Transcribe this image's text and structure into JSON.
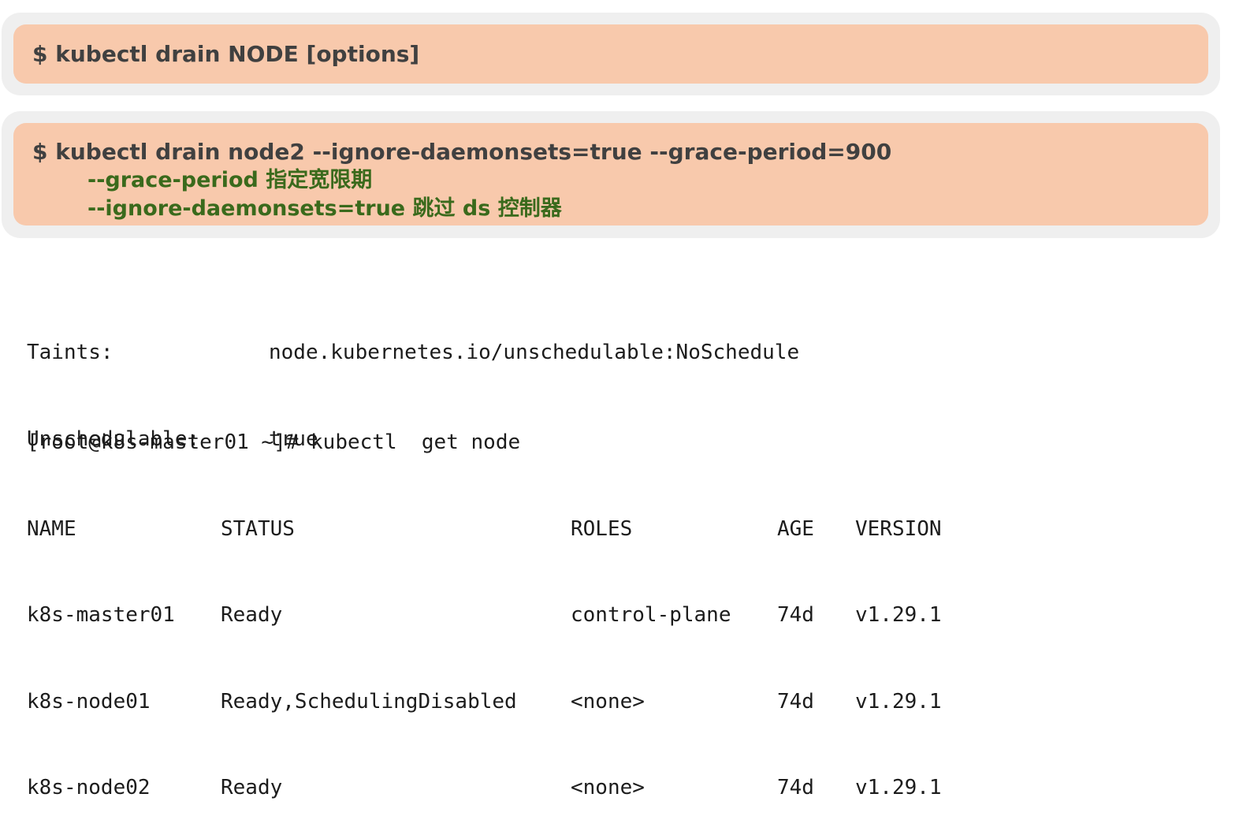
{
  "card1": {
    "command": "$ kubectl drain NODE [options]"
  },
  "card2": {
    "command": "$ kubectl drain node2 --ignore-daemonsets=true --grace-period=900",
    "notes": [
      "--grace-period 指定宽限期",
      "--ignore-daemonsets=true 跳过 ds 控制器"
    ]
  },
  "describe": [
    {
      "key": "Taints:",
      "value": "node.kubernetes.io/unschedulable:NoSchedule"
    },
    {
      "key": "Unschedulable:",
      "value": "true"
    }
  ],
  "get_node": {
    "prompt": "[root@k8s-master01 ~]# kubectl  get node",
    "headers": [
      "NAME",
      "STATUS",
      "ROLES",
      "AGE",
      "VERSION"
    ],
    "rows": [
      [
        "k8s-master01",
        "Ready",
        "control-plane",
        "74d",
        "v1.29.1"
      ],
      [
        "k8s-node01",
        "Ready,SchedulingDisabled",
        "<none>",
        "74d",
        "v1.29.1"
      ],
      [
        "k8s-node02",
        "Ready",
        "<none>",
        "74d",
        "v1.29.1"
      ]
    ]
  }
}
